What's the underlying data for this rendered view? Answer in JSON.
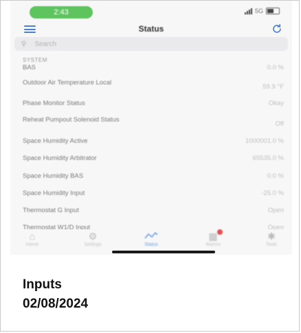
{
  "status_bar": {
    "time": "2:43",
    "network": "5G"
  },
  "header": {
    "title": "Status"
  },
  "search": {
    "placeholder": "Search"
  },
  "section": {
    "label": "SYSTEM"
  },
  "rows": [
    {
      "label": "BAS",
      "value": "0.0 %"
    },
    {
      "label": "Outdoor Air Temperature Local",
      "value": "59.9 °F"
    },
    {
      "label": "Phase Monitor Status",
      "value": "Okay"
    },
    {
      "label": "Reheat Pumpout Solenoid Status",
      "value": "Off"
    },
    {
      "label": "Space Humidity Active",
      "value": "1000001.0 %"
    },
    {
      "label": "Space Humidity Arbitrator",
      "value": "65535.0 %"
    },
    {
      "label": "Space Humidity BAS",
      "value": "0.0 %"
    },
    {
      "label": "Space Humidity Input",
      "value": "-25.0 %"
    },
    {
      "label": "Thermostat G Input",
      "value": "Open"
    },
    {
      "label": "Thermostat W1/D Input",
      "value": "Open"
    }
  ],
  "tabs": [
    {
      "label": "Home",
      "icon": "house-icon"
    },
    {
      "label": "Settings",
      "icon": "gear-icon"
    },
    {
      "label": "Status",
      "icon": "line-chart-icon"
    },
    {
      "label": "Alarms",
      "icon": "alarm-icon"
    },
    {
      "label": "Tools",
      "icon": "tools-icon"
    }
  ],
  "caption": {
    "line1": "Inputs",
    "line2": "02/08/2024"
  },
  "colors": {
    "accent": "#4a7fd0",
    "time_pill": "#5ec45e",
    "badge": "#e35050"
  }
}
